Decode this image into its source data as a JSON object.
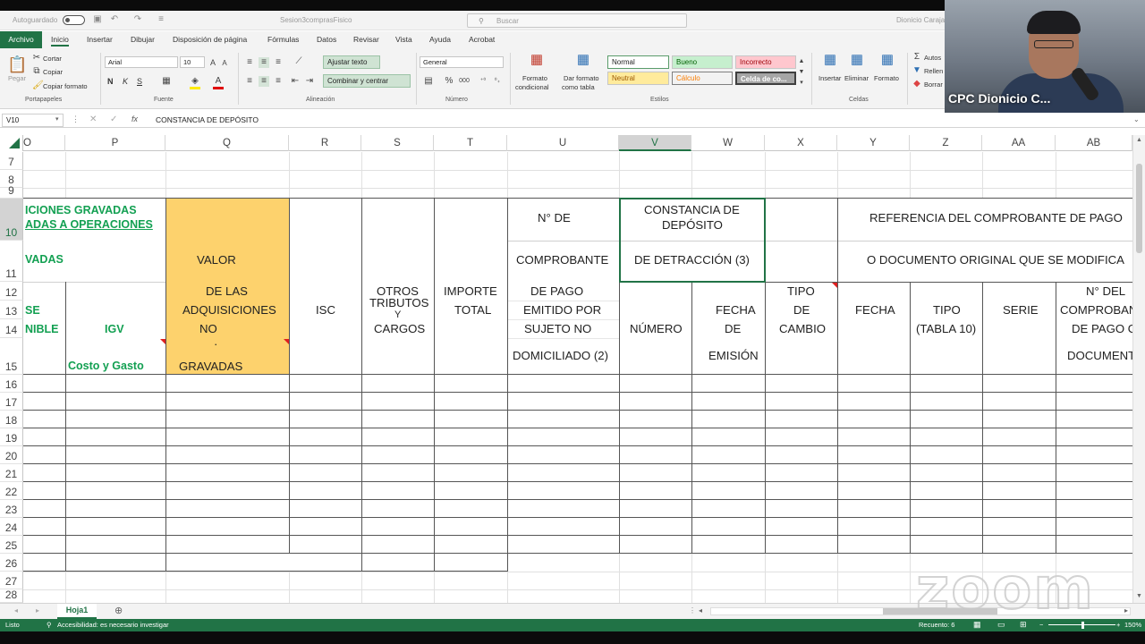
{
  "titlebar": {
    "autosave": "Autoguardado",
    "filename": "Sesion3comprasFisico",
    "search_placeholder": "Buscar",
    "user": "Dionicio Caraja"
  },
  "menu": [
    "Archivo",
    "Inicio",
    "Insertar",
    "Dibujar",
    "Disposición de página",
    "Fórmulas",
    "Datos",
    "Revisar",
    "Vista",
    "Ayuda",
    "Acrobat"
  ],
  "ribbon": {
    "clipboard": {
      "paste": "Pegar",
      "cut": "Cortar",
      "copy": "Copiar",
      "format_painter": "Copiar formato",
      "group": "Portapapeles"
    },
    "font": {
      "name": "Arial",
      "size": "10",
      "bold": "N",
      "italic": "K",
      "underline": "S",
      "group": "Fuente"
    },
    "alignment": {
      "wrap": "Ajustar texto",
      "merge": "Combinar y centrar",
      "group": "Alineación"
    },
    "number": {
      "format": "General",
      "group": "Número"
    },
    "styles": {
      "cond_format_1": "Formato",
      "cond_format_2": "condicional",
      "table_format_1": "Dar formato",
      "table_format_2": "como tabla",
      "normal": "Normal",
      "good": "Bueno",
      "bad": "Incorrecto",
      "neutral": "Neutral",
      "calc": "Cálculo",
      "check": "Celda de co...",
      "group": "Estilos"
    },
    "cells": {
      "insert": "Insertar",
      "delete": "Eliminar",
      "format": "Formato",
      "group": "Celdas"
    },
    "editing": {
      "autosum": "Autos",
      "fill": "Rellen",
      "clear": "Borrar"
    }
  },
  "formula_bar": {
    "cell_ref": "V10",
    "content": "CONSTANCIA DE DEPÓSITO"
  },
  "webcam": {
    "name": "CPC Dionicio C..."
  },
  "columns": [
    "O",
    "P",
    "Q",
    "R",
    "S",
    "T",
    "U",
    "V",
    "W",
    "X",
    "Y",
    "Z",
    "AA",
    "AB"
  ],
  "rows": [
    "7",
    "8",
    "9",
    "10",
    "11",
    "12",
    "13",
    "14",
    "15",
    "16",
    "17",
    "18",
    "19",
    "20",
    "21",
    "22",
    "23",
    "24",
    "25",
    "26",
    "27",
    "28"
  ],
  "cells": {
    "o10a": "ICIONES GRAVADAS",
    "o10b": "ADAS A OPERACIONES",
    "o11": "VADAS",
    "o13": "SE",
    "o14": "NIBLE",
    "p14": "IGV",
    "p15": "Costo y Gasto",
    "q11": "VALOR",
    "q12": "DE LAS",
    "q13": "ADQUISICIONES",
    "q14": "NO",
    "q14dot": "·",
    "q15": "GRAVADAS",
    "r13": "ISC",
    "s12": "OTROS",
    "s13a": "TRIBUTOS",
    "s13b": "Y",
    "s14": "CARGOS",
    "t12": "IMPORTE",
    "t13": "TOTAL",
    "u10": "N° DE",
    "u11": "COMPROBANTE",
    "u12": "DE PAGO",
    "u13": "EMITIDO POR",
    "u14": "SUJETO NO",
    "u15": "DOMICILIADO (2)",
    "v10a": "CONSTANCIA DE",
    "v10b": "DEPÓSITO",
    "v11": "DE DETRACCIÓN (3)",
    "v14": "NÚMERO",
    "w13": "FECHA",
    "w14": "DE",
    "w15": "EMISIÓN",
    "x12": "TIPO",
    "x13": "DE",
    "x14": "CAMBIO",
    "y10": "REFERENCIA DEL COMPROBANTE DE PAGO",
    "y11": "O DOCUMENTO ORIGINAL QUE SE MODIFICA",
    "y13": "FECHA",
    "z13": "TIPO",
    "z14": "(TABLA 10)",
    "aa13": "SERIE",
    "ab12": "N° DEL",
    "ab13": "COMPROBAN",
    "ab14": "DE PAGO O",
    "ab15": "DOCUMENT"
  },
  "sheet_tab": "Hoja1",
  "status": {
    "ready": "Listo",
    "accessibility": "Accesibilidad: es necesario investigar",
    "count": "Recuento: 6",
    "zoom": "150%"
  },
  "watermark": "zoom",
  "colors": {
    "accent": "#217346",
    "highlight": "#fdd26d",
    "green_text": "#13a052"
  }
}
